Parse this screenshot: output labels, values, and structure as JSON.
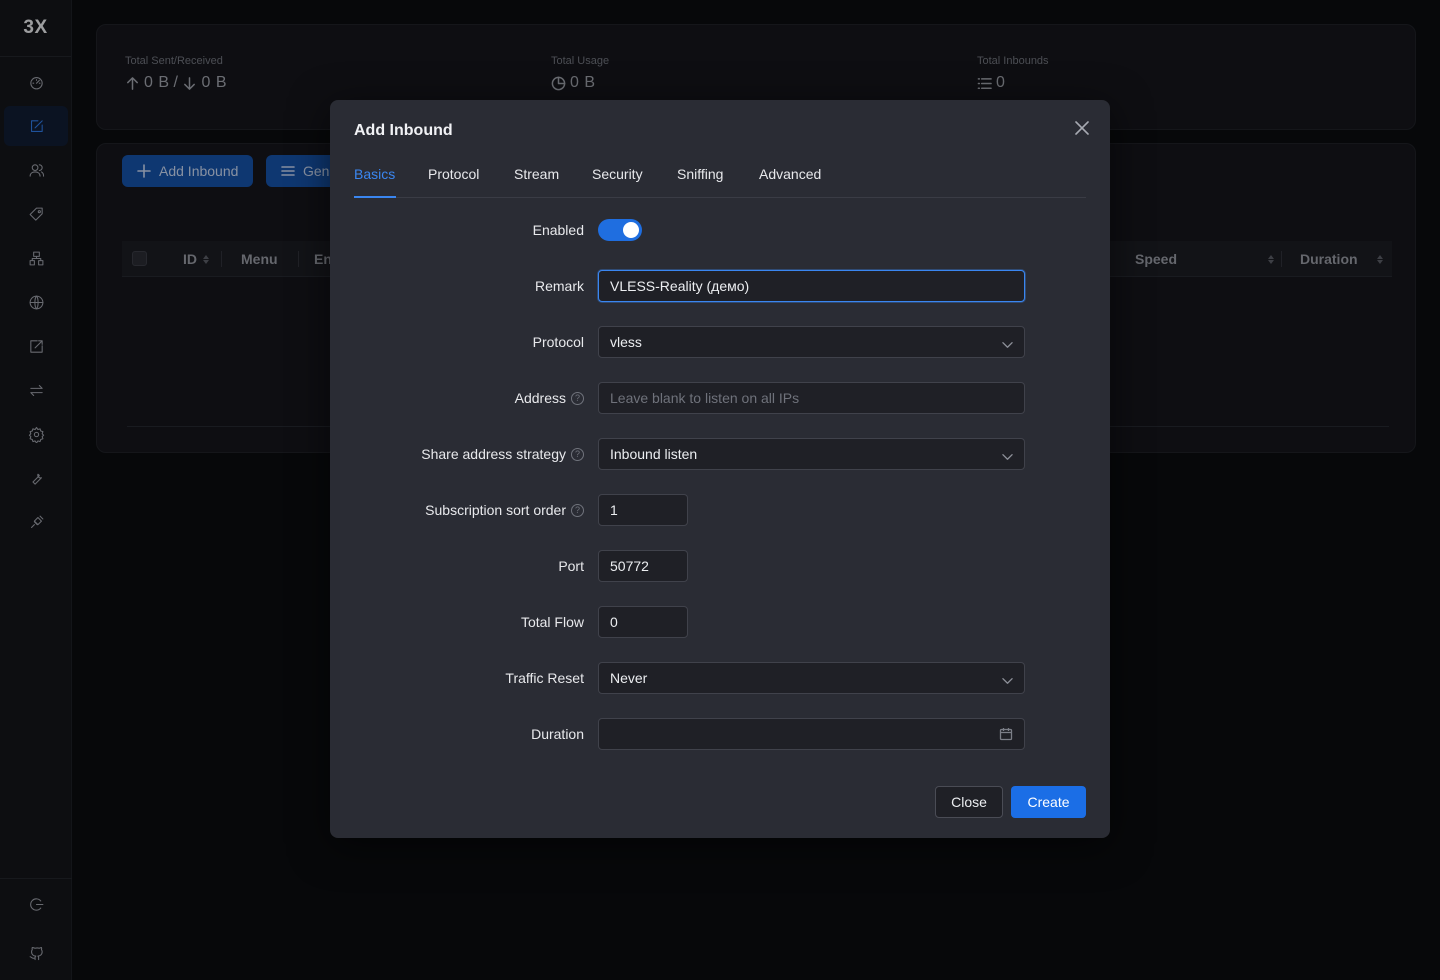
{
  "app": {
    "logo": "3X"
  },
  "sidebar": {
    "items": [
      {
        "icon": "dashboard-icon",
        "active": false
      },
      {
        "icon": "inbounds-icon",
        "active": true
      },
      {
        "icon": "users-icon",
        "active": false
      },
      {
        "icon": "tag-icon",
        "active": false
      },
      {
        "icon": "network-icon",
        "active": false
      },
      {
        "icon": "globe-icon",
        "active": false
      },
      {
        "icon": "external-link-icon",
        "active": false
      },
      {
        "icon": "swap-icon",
        "active": false
      },
      {
        "icon": "settings-icon",
        "active": false
      },
      {
        "icon": "wrench-icon",
        "active": false
      },
      {
        "icon": "plugin-icon",
        "active": false
      }
    ],
    "bottom": [
      {
        "icon": "logout-icon"
      },
      {
        "icon": "github-icon"
      }
    ]
  },
  "stats": {
    "sent_received": {
      "label": "Total Sent/Received",
      "sent": "0 B",
      "separator": "/",
      "received": "0 B"
    },
    "usage": {
      "label": "Total Usage",
      "value": "0 B"
    },
    "inbounds": {
      "label": "Total Inbounds",
      "value": "0"
    }
  },
  "toolbar": {
    "add_inbound": "Add Inbound",
    "general_actions": "Gen"
  },
  "table": {
    "columns": {
      "id": "ID",
      "menu": "Menu",
      "enable": "En",
      "speed": "Speed",
      "duration": "Duration"
    }
  },
  "modal": {
    "title": "Add Inbound",
    "tabs": [
      "Basics",
      "Protocol",
      "Stream",
      "Security",
      "Sniffing",
      "Advanced"
    ],
    "active_tab": "Basics",
    "fields": {
      "enabled": {
        "label": "Enabled",
        "value": true
      },
      "remark": {
        "label": "Remark",
        "value": "VLESS-Reality (демо)"
      },
      "protocol": {
        "label": "Protocol",
        "value": "vless"
      },
      "address": {
        "label": "Address",
        "placeholder": "Leave blank to listen on all IPs"
      },
      "share_strategy": {
        "label": "Share address strategy",
        "value": "Inbound listen"
      },
      "sort_order": {
        "label": "Subscription sort order",
        "value": "1"
      },
      "port": {
        "label": "Port",
        "value": "50772"
      },
      "total_flow": {
        "label": "Total Flow",
        "value": "0"
      },
      "traffic_reset": {
        "label": "Traffic Reset",
        "value": "Never"
      },
      "duration": {
        "label": "Duration",
        "value": ""
      }
    },
    "buttons": {
      "close": "Close",
      "create": "Create"
    }
  },
  "colors": {
    "accent": "#1b6ee6",
    "background": "#0b0c0f",
    "modal": "#2a2c34"
  }
}
